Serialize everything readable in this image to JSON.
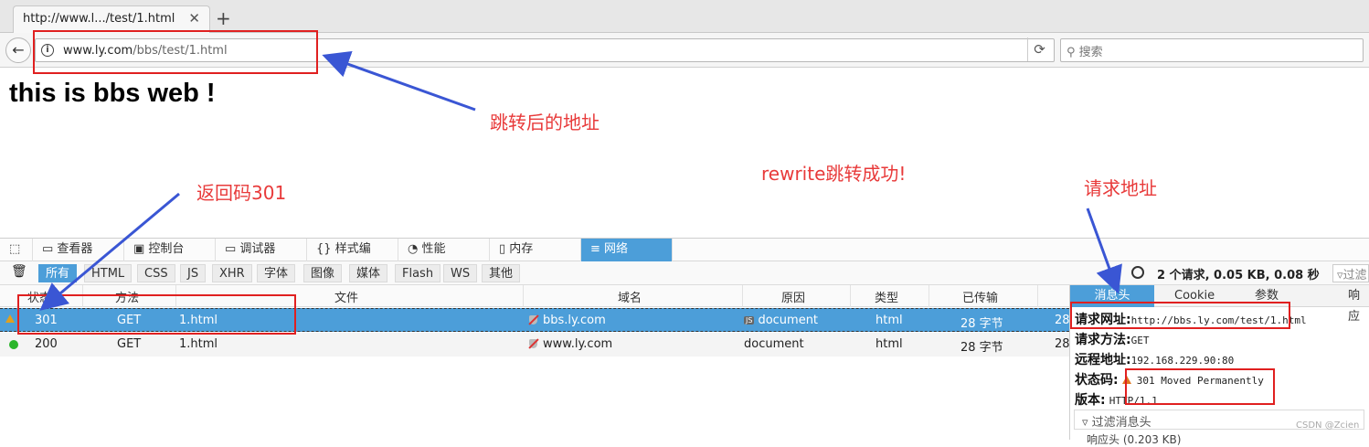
{
  "browser": {
    "tab_title": "http://www.l.../test/1.html",
    "tab_close": "✕",
    "new_tab": "+",
    "url_host": "www.ly.com",
    "url_path": "/bbs/test/1.html",
    "search_placeholder": "搜索"
  },
  "page": {
    "heading": "this is bbs web !"
  },
  "annotations": {
    "after_redirect": "跳转后的地址",
    "return_code": "返回码301",
    "rewrite_success": "rewrite跳转成功!",
    "request_url": "请求地址",
    "color": "#e83a3a",
    "arrow_color": "#3a56d4"
  },
  "devtools": {
    "tabs": [
      {
        "label": "查看器",
        "icon": "inspector-icon"
      },
      {
        "label": "控制台",
        "icon": "console-icon"
      },
      {
        "label": "调试器",
        "icon": "debugger-icon"
      },
      {
        "label": "样式编辑...",
        "icon": "style-editor-icon"
      },
      {
        "label": "性能",
        "icon": "performance-icon"
      },
      {
        "label": "内存",
        "icon": "memory-icon"
      },
      {
        "label": "网络",
        "icon": "network-icon",
        "active": true
      }
    ],
    "filters": [
      "所有",
      "HTML",
      "CSS",
      "JS",
      "XHR",
      "字体",
      "图像",
      "媒体",
      "Flash",
      "WS",
      "其他"
    ],
    "summary": "2 个请求, 0.05 KB, 0.08 秒",
    "filter_url_placeholder": "过滤",
    "columns": [
      "状态",
      "方法",
      "文件",
      "域名",
      "原因",
      "类型",
      "已传输"
    ],
    "rows": [
      {
        "status": "301",
        "method": "GET",
        "file": "1.html",
        "domain": "bbs.ly.com",
        "cause": "document",
        "type": "html",
        "transferred": "28 字节",
        "size": "28"
      },
      {
        "status": "200",
        "method": "GET",
        "file": "1.html",
        "domain": "www.ly.com",
        "cause": "document",
        "type": "html",
        "transferred": "28 字节",
        "size": "28"
      }
    ],
    "side_tabs": [
      "消息头",
      "Cookie",
      "参数",
      "响应"
    ],
    "details": {
      "request_url_label": "请求网址:",
      "request_url": "http://bbs.ly.com/test/1.html",
      "method_label": "请求方法:",
      "method": "GET",
      "remote_label": "远程地址:",
      "remote": "192.168.229.90:80",
      "status_label": "状态码:",
      "status": "301 Moved Permanently",
      "version_label": "版本:",
      "version": "HTTP/1.1",
      "filter_headers": "过滤消息头",
      "response_headers": "响应头 (0.203 KB)"
    }
  },
  "watermark": "CSDN @Zcien"
}
